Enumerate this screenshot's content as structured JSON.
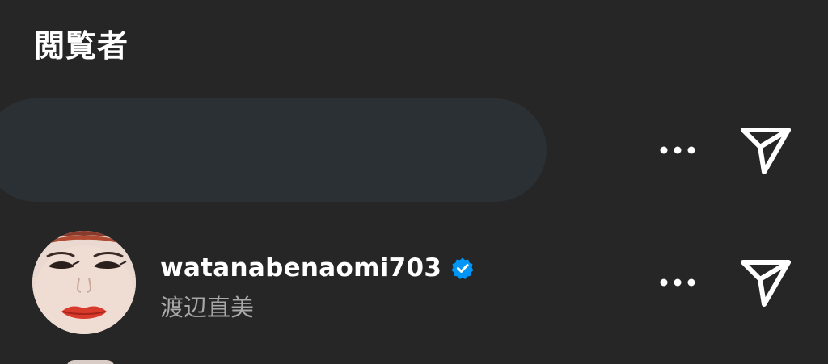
{
  "header": {
    "title": "閲覧者"
  },
  "viewers": [
    {
      "redacted": true,
      "more_icon": "more-horizontal-icon",
      "send_icon": "paper-plane-icon"
    },
    {
      "redacted": false,
      "username": "watanabenaomi703",
      "full_name": "渡辺直美",
      "verified": true,
      "more_icon": "more-horizontal-icon",
      "send_icon": "paper-plane-icon"
    }
  ],
  "colors": {
    "background": "#262626",
    "redaction": "#2b3035",
    "verified_badge": "#0095f6",
    "secondary_text": "#a8a8a8",
    "primary_text": "#ffffff"
  }
}
